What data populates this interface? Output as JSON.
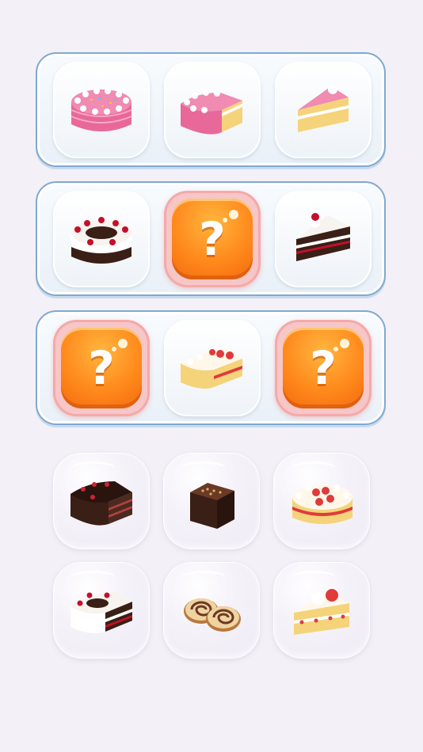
{
  "board": {
    "rows": [
      {
        "slots": [
          {
            "state": "revealed",
            "item": "pink-sprinkle-cake-icon"
          },
          {
            "state": "revealed",
            "item": "pink-cake-cut-icon"
          },
          {
            "state": "revealed",
            "item": "pink-cake-slice-icon"
          }
        ]
      },
      {
        "slots": [
          {
            "state": "revealed",
            "item": "black-forest-cake-icon"
          },
          {
            "state": "hidden",
            "label": "?"
          },
          {
            "state": "revealed",
            "item": "black-forest-slice-icon"
          }
        ]
      },
      {
        "slots": [
          {
            "state": "hidden",
            "label": "?"
          },
          {
            "state": "revealed",
            "item": "strawberry-cake-cut-icon"
          },
          {
            "state": "hidden",
            "label": "?"
          }
        ]
      }
    ]
  },
  "tray": {
    "items": [
      {
        "item": "chocolate-cake-cut-icon"
      },
      {
        "item": "chocolate-brownie-icon"
      },
      {
        "item": "strawberry-cream-cake-icon"
      },
      {
        "item": "black-forest-cake-cut-icon"
      },
      {
        "item": "swiss-roll-icon"
      },
      {
        "item": "strawberry-shortcake-slice-icon"
      }
    ]
  },
  "colors": {
    "board_border": "#7fa9d1",
    "question_orange": "#ff8a1c",
    "hidden_slot_pink": "#f7c6c6",
    "background": "#f3f0f7"
  }
}
